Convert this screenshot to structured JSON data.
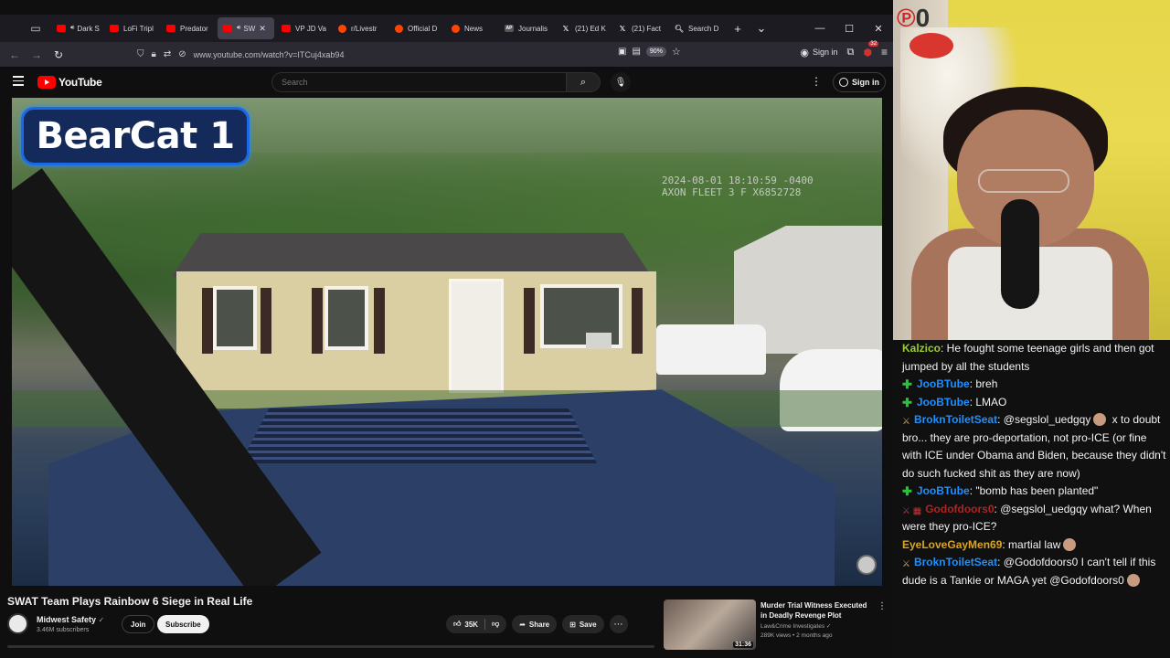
{
  "browser": {
    "tabs": [
      {
        "label": "Dark S",
        "favicon": "youtube-icon",
        "active": false,
        "speaker": true
      },
      {
        "label": "LoFi Tripl",
        "favicon": "youtube-icon",
        "active": false
      },
      {
        "label": "Predator",
        "favicon": "youtube-icon",
        "active": false
      },
      {
        "label": "SW",
        "favicon": "youtube-icon",
        "active": true,
        "speaker": true
      },
      {
        "label": "VP JD Va",
        "favicon": "youtube-icon",
        "active": false
      },
      {
        "label": "r/Livestr",
        "favicon": "reddit-icon",
        "active": false
      },
      {
        "label": "Official D",
        "favicon": "reddit-icon",
        "active": false
      },
      {
        "label": "News",
        "favicon": "reddit-icon",
        "active": false
      },
      {
        "label": "Journalis",
        "favicon": "ap-icon",
        "active": false
      },
      {
        "label": "(21) Ed K",
        "favicon": "x-icon",
        "active": false
      },
      {
        "label": "(21) Fact",
        "favicon": "x-icon",
        "active": false
      },
      {
        "label": "Search D",
        "favicon": "search-icon",
        "active": false
      }
    ],
    "url": "www.youtube.com/watch?v=ITCuj4xab94",
    "zoom": "90%",
    "signin_label": "Sign in",
    "extension_count": "32"
  },
  "youtube": {
    "logo_text": "YouTube",
    "search_placeholder": "Search",
    "signin_label": "Sign in",
    "video": {
      "overlay_title": "BearCat 1",
      "timestamp_line1": "2024-08-01 18:10:59 -0400",
      "timestamp_line2": "AXON FLEET 3 F X6852728"
    },
    "title": "SWAT Team Plays Rainbow 6 Siege in Real Life",
    "channel": {
      "name": "Midwest Safety",
      "subscribers": "3.46M subscribers",
      "join_label": "Join",
      "subscribe_label": "Subscribe"
    },
    "actions": {
      "likes": "35K",
      "share_label": "Share",
      "save_label": "Save"
    },
    "recommendation": {
      "title": "Murder Trial Witness Executed in Deadly Revenge Plot",
      "channel": "Law&Crime Investigates",
      "meta": "289K views • 2 months ago",
      "duration": "31:36"
    }
  },
  "webcam": {
    "logo_text": "0"
  },
  "chat": {
    "messages": [
      {
        "user": "Kalzico",
        "color": "#9acd32",
        "badge": "none",
        "text": ": He fought some teenage girls and then got jumped by all the students"
      },
      {
        "user": "JooBTube",
        "color": "#1e90ff",
        "badge": "plus",
        "text": ": breh"
      },
      {
        "user": "JooBTube",
        "color": "#1e90ff",
        "badge": "plus",
        "text": ": LMAO"
      },
      {
        "user": "BroknToiletSeat",
        "color": "#1e90ff",
        "badge": "sword",
        "text": ": @segslol_uedgqy",
        "emote": true,
        "text2": " x to doubt bro... they are pro-deportation, not pro-ICE (or fine with ICE under Obama and Biden, because they didn't do such fucked shit as they are now)"
      },
      {
        "user": "JooBTube",
        "color": "#1e90ff",
        "badge": "plus",
        "text": ": \"bomb has been planted\""
      },
      {
        "user": "Godofdoors0",
        "color": "#b22222",
        "badge": "double",
        "text": ": @segslol_uedgqy what? When were they pro-ICE?"
      },
      {
        "user": "EyeLoveGayMen69",
        "color": "#daa520",
        "badge": "none",
        "text": ": martial law",
        "emote": true
      },
      {
        "user": "BroknToiletSeat",
        "color": "#1e90ff",
        "badge": "sword",
        "text": ": @Godofdoors0 I can't tell if this dude is a Tankie or MAGA yet @Godofdoors0",
        "emote": true
      }
    ]
  },
  "colors": {
    "youtube_red": "#ff0000",
    "bearcat_blue": "#1a6ae8",
    "chat_plus_badge": "#27c43a"
  }
}
